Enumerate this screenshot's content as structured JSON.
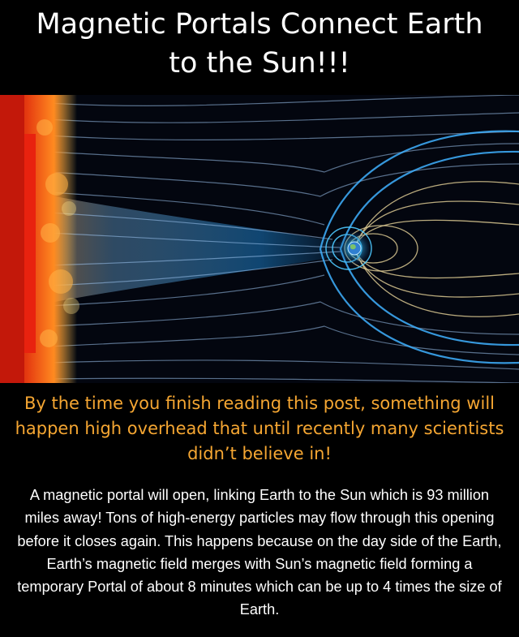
{
  "title": {
    "line1": "Magnetic Portals Connect Earth",
    "line2": "to the Sun!!!"
  },
  "image": {
    "icon": "sun-earth-magnetosphere-illustration"
  },
  "subtitle": "By the time you finish reading this post, something will happen high overhead that until recently many scientists didn’t believe in!",
  "body": "A magnetic portal will open, linking Earth to the Sun which is 93 million miles away! Tons of high-energy particles may flow through this opening before it closes again. This happens because on the day side of the Earth, Earth’s magnetic field merges with Sun’s magnetic field forming a temporary Portal of about 8 minutes which can be up to 4 times the size of Earth.",
  "colors": {
    "background": "#000000",
    "title": "#ffffff",
    "subtitle": "#f5a632",
    "body": "#ffffff"
  }
}
